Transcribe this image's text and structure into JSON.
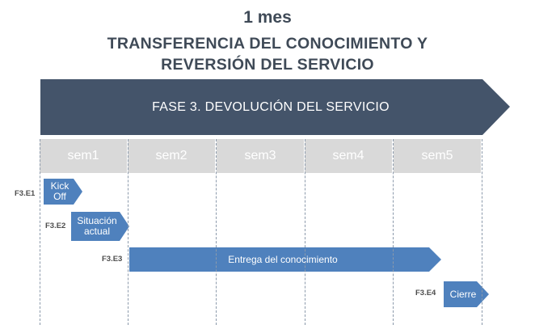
{
  "header": {
    "duration": "1 mes",
    "title_line1": "TRANSFERENCIA DEL CONOCIMIENTO  Y",
    "title_line2": "REVERSIÓN DEL SERVICIO"
  },
  "phase": {
    "label": "FASE 3. DEVOLUCIÓN  DEL SERVICIO"
  },
  "weeks": [
    "sem1",
    "sem2",
    "sem3",
    "sem4",
    "sem5"
  ],
  "tasks": [
    {
      "code": "F3.E1",
      "label_line1": "Kick",
      "label_line2": "Off"
    },
    {
      "code": "F3.E2",
      "label_line1": "Situación",
      "label_line2": "actual"
    },
    {
      "code": "F3.E3",
      "label_line1": "Entrega del conocimiento",
      "label_line2": ""
    },
    {
      "code": "F3.E4",
      "label_line1": "Cierre",
      "label_line2": ""
    }
  ],
  "colors": {
    "phase_fill": "#44546a",
    "task_fill": "#4f81bd",
    "week_fill": "#d9d9d9",
    "title_text": "#3f4a57"
  }
}
